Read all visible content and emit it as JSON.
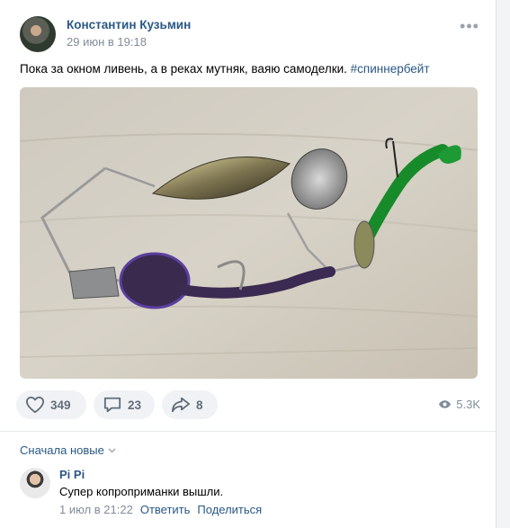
{
  "post": {
    "author": "Константин Кузьмин",
    "date": "29 июн в 19:18",
    "more_icon": "more-horizontal-icon",
    "text": "Пока за окном ливень, а в реках мутняк, ваяю самоделки.",
    "hashtag": "#спиннербейт"
  },
  "actions": {
    "likes": "349",
    "comments": "23",
    "shares": "8",
    "views": "5.3K",
    "icons": [
      "heart-icon",
      "comment-icon",
      "share-icon",
      "eye-icon"
    ]
  },
  "comments": {
    "sort_label": "Сначала новые",
    "items": [
      {
        "author": "Pi Pi",
        "text": "Супер копроприманки вышли.",
        "date": "1 июл в 21:22",
        "reply_label": "Ответить",
        "share_label": "Поделиться"
      }
    ]
  },
  "colors": {
    "link": "#2a5885",
    "secondary": "#818c99",
    "pill_bg": "#f0f2f5"
  }
}
